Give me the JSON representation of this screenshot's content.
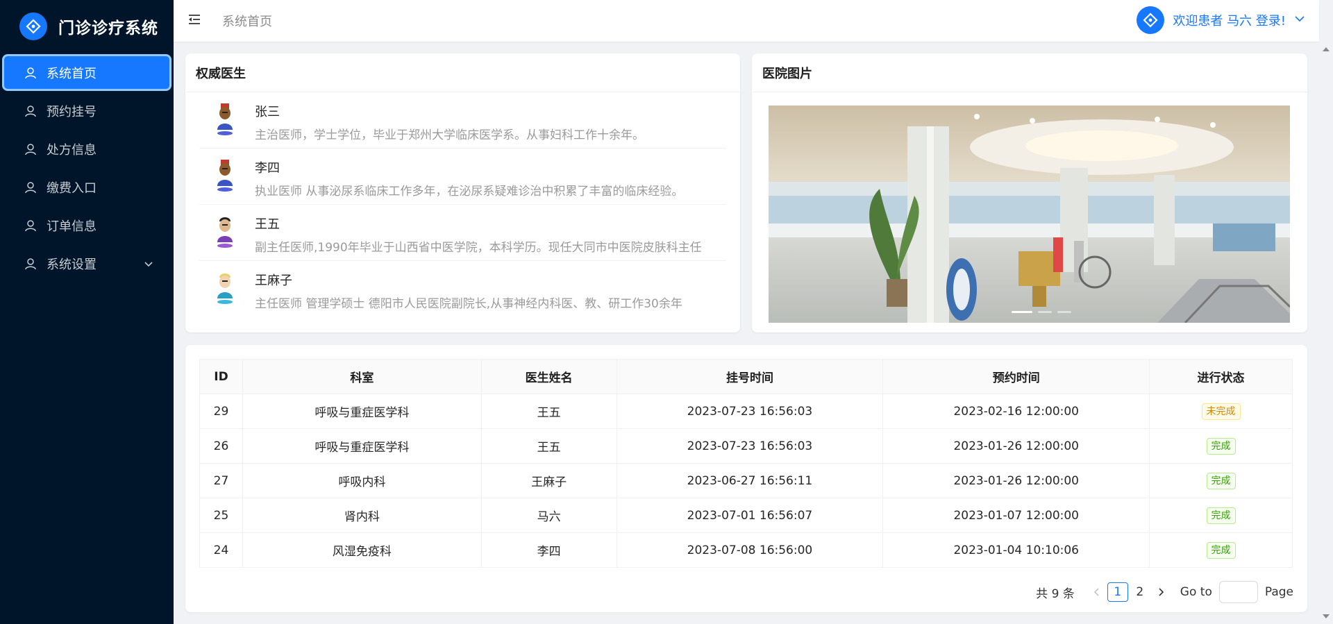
{
  "app": {
    "title": "门诊诊疗系统"
  },
  "sidebar": {
    "items": [
      {
        "label": "系统首页",
        "active": true
      },
      {
        "label": "预约挂号"
      },
      {
        "label": "处方信息"
      },
      {
        "label": "缴费入口"
      },
      {
        "label": "订单信息"
      },
      {
        "label": "系统设置",
        "has_submenu": true
      }
    ]
  },
  "header": {
    "breadcrumb": "系统首页",
    "welcome": "欢迎患者 马六 登录!"
  },
  "doctors_card": {
    "title": "权威医生",
    "doctors": [
      {
        "name": "张三",
        "desc": "主治医师，学士学位，毕业于郑州大学临床医学系。从事妇科工作十余年。"
      },
      {
        "name": "李四",
        "desc": "执业医师 从事泌尿系临床工作多年，在泌尿系疑难诊治中积累了丰富的临床经验。"
      },
      {
        "name": "王五",
        "desc": "副主任医师,1990年毕业于山西省中医学院，本科学历。现任大同市中医院皮肤科主任"
      },
      {
        "name": "王麻子",
        "desc": "主任医师 管理学硕士 德阳市人民医院副院长,从事神经内科医、教、研工作30余年"
      }
    ]
  },
  "pics_card": {
    "title": "医院图片",
    "active_slide": 1,
    "slide_count": 3
  },
  "table": {
    "columns": [
      "ID",
      "科室",
      "医生姓名",
      "挂号时间",
      "预约时间",
      "进行状态"
    ],
    "rows": [
      {
        "id": "29",
        "dept": "呼吸与重症医学科",
        "doctor": "王五",
        "reg_time": "2023-07-23 16:56:03",
        "appt_time": "2023-02-16 12:00:00",
        "status": "未完成"
      },
      {
        "id": "26",
        "dept": "呼吸与重症医学科",
        "doctor": "王五",
        "reg_time": "2023-07-23 16:56:03",
        "appt_time": "2023-01-26 12:00:00",
        "status": "完成"
      },
      {
        "id": "27",
        "dept": "呼吸内科",
        "doctor": "王麻子",
        "reg_time": "2023-06-27 16:56:11",
        "appt_time": "2023-01-26 12:00:00",
        "status": "完成"
      },
      {
        "id": "25",
        "dept": "肾内科",
        "doctor": "马六",
        "reg_time": "2023-07-01 16:56:07",
        "appt_time": "2023-01-07 12:00:00",
        "status": "完成"
      },
      {
        "id": "24",
        "dept": "风湿免疫科",
        "doctor": "李四",
        "reg_time": "2023-07-08 16:56:00",
        "appt_time": "2023-01-04 10:10:06",
        "status": "完成"
      }
    ]
  },
  "pagination": {
    "total": "共 9 条",
    "pages": [
      "1",
      "2"
    ],
    "current": "1",
    "goto_label": "Go to",
    "page_label": "Page"
  },
  "colors": {
    "primary": "#1677ff",
    "sidebar_bg": "#001529",
    "warn": "#d48806",
    "success": "#389e0d"
  }
}
